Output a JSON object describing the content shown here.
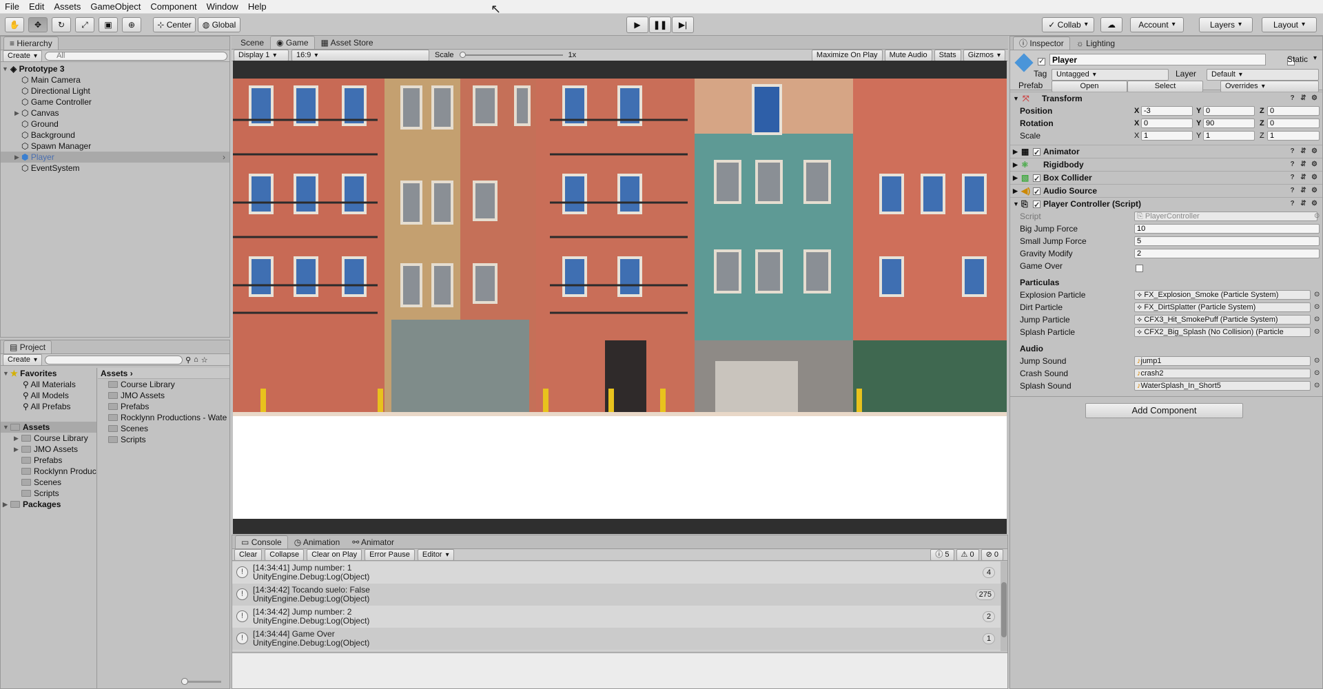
{
  "menu": [
    "File",
    "Edit",
    "Assets",
    "GameObject",
    "Component",
    "Window",
    "Help"
  ],
  "toolbar": {
    "center_label": "Center",
    "global_label": "Global",
    "collab_label": "Collab",
    "account_label": "Account",
    "layers_label": "Layers",
    "layout_label": "Layout"
  },
  "hierarchy": {
    "tab": "Hierarchy",
    "create_label": "Create",
    "search_placeholder": "All",
    "scene_name": "Prototype 3",
    "items": [
      "Main Camera",
      "Directional Light",
      "Game Controller",
      "Canvas",
      "Ground",
      "Background",
      "Spawn Manager",
      "Player",
      "EventSystem"
    ]
  },
  "project": {
    "tab": "Project",
    "create_label": "Create",
    "favorites_label": "Favorites",
    "favorites": [
      "All Materials",
      "All Models",
      "All Prefabs"
    ],
    "assets_label": "Assets",
    "asset_tree": [
      "Course Library",
      "JMO Assets",
      "Prefabs",
      "Rocklynn Productions - Wate",
      "Scenes",
      "Scripts"
    ],
    "packages_label": "Packages",
    "breadcrumb": "Assets",
    "asset_list": [
      "Course Library",
      "JMO Assets",
      "Prefabs",
      "Rocklynn Productions - Wate",
      "Scenes",
      "Scripts"
    ]
  },
  "center_tabs": [
    "Scene",
    "Game",
    "Asset Store"
  ],
  "game_bar": {
    "display": "Display 1",
    "aspect": "16:9",
    "scale_label": "Scale",
    "scale_value": "1x",
    "maximize": "Maximize On Play",
    "mute": "Mute Audio",
    "stats": "Stats",
    "gizmos": "Gizmos"
  },
  "console": {
    "tabs": [
      "Console",
      "Animation",
      "Animator"
    ],
    "buttons": [
      "Clear",
      "Collapse",
      "Clear on Play",
      "Error Pause",
      "Editor"
    ],
    "counts": {
      "log": "5",
      "warn": "0",
      "error": "0"
    },
    "rows": [
      {
        "line1": "[14:34:41] Jump number: 1",
        "line2": "UnityEngine.Debug:Log(Object)",
        "count": "4"
      },
      {
        "line1": "[14:34:42] Tocando suelo: False",
        "line2": "UnityEngine.Debug:Log(Object)",
        "count": "275"
      },
      {
        "line1": "[14:34:42] Jump number: 2",
        "line2": "UnityEngine.Debug:Log(Object)",
        "count": "2"
      },
      {
        "line1": "[14:34:44] Game Over",
        "line2": "UnityEngine.Debug:Log(Object)",
        "count": "1"
      }
    ]
  },
  "inspector": {
    "tabs": [
      "Inspector",
      "Lighting"
    ],
    "object_name": "Player",
    "static_label": "Static",
    "tag_label": "Tag",
    "tag_value": "Untagged",
    "layer_label": "Layer",
    "layer_value": "Default",
    "prefab_label": "Prefab",
    "open_label": "Open",
    "select_label": "Select",
    "overrides_label": "Overrides",
    "transform": {
      "title": "Transform",
      "position_label": "Position",
      "rotation_label": "Rotation",
      "scale_label": "Scale",
      "position": [
        "-3",
        "0",
        "0"
      ],
      "rotation": [
        "0",
        "90",
        "0"
      ],
      "scale": [
        "1",
        "1",
        "1"
      ]
    },
    "components": [
      "Animator",
      "Rigidbody",
      "Box Collider",
      "Audio Source",
      "Player Controller (Script)"
    ],
    "script_label": "Script",
    "script_value": "PlayerController",
    "fields": [
      {
        "label": "Big Jump Force",
        "value": "10"
      },
      {
        "label": "Small Jump Force",
        "value": "5"
      },
      {
        "label": "Gravity Modify",
        "value": "2"
      }
    ],
    "game_over_label": "Game Over",
    "particulas_header": "Particulas",
    "particles": [
      {
        "label": "Explosion Particle",
        "value": "FX_Explosion_Smoke (Particle System)"
      },
      {
        "label": "Dirt Particle",
        "value": "FX_DirtSplatter (Particle System)"
      },
      {
        "label": "Jump Particle",
        "value": "CFX3_Hit_SmokePuff (Particle System)"
      },
      {
        "label": "Splash Particle",
        "value": "CFX2_Big_Splash (No Collision) (Particle"
      }
    ],
    "audio_header": "Audio",
    "audio": [
      {
        "label": "Jump Sound",
        "value": "jump1"
      },
      {
        "label": "Crash Sound",
        "value": "crash2"
      },
      {
        "label": "Splash Sound",
        "value": "WaterSplash_In_Short5"
      }
    ],
    "add_component": "Add Component"
  }
}
